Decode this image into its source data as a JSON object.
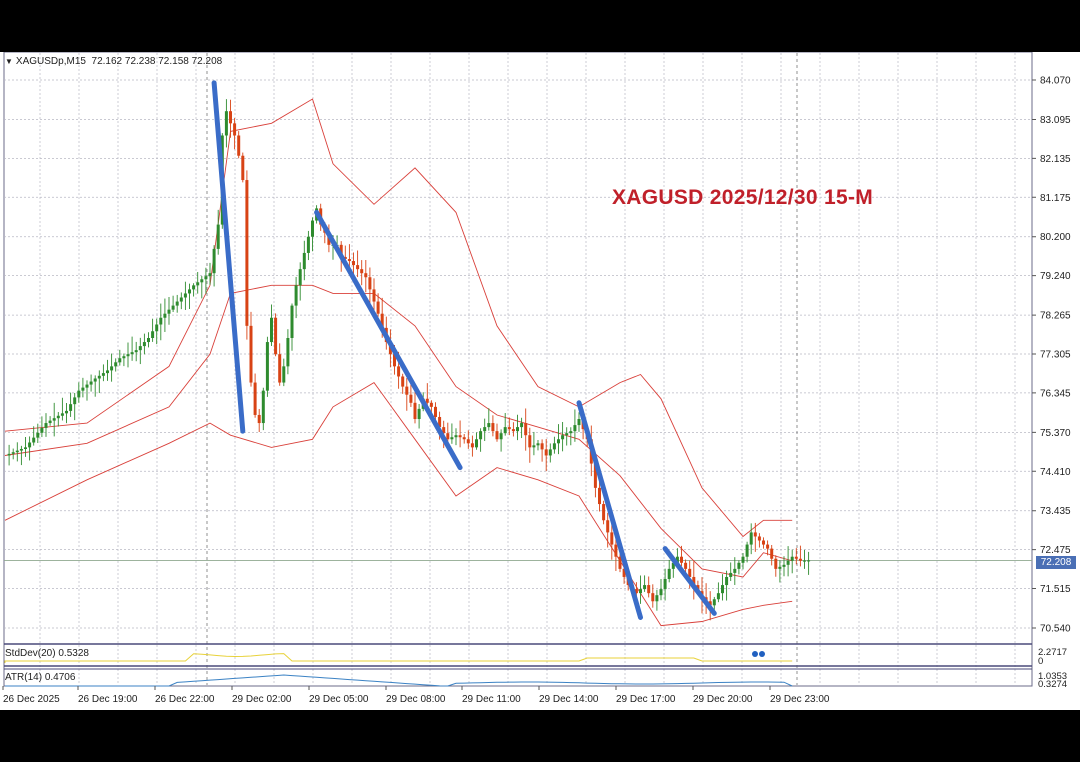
{
  "header": {
    "symbol": "XAGUSDp,M15",
    "ohlc": "72.162 72.238 72.158 72.208"
  },
  "overlay_title": "XAGUSD 2025/12/30 15-M",
  "current_price": "72.208",
  "colors": {
    "bull": "#2e8b2e",
    "bear": "#d84315",
    "band": "#d9403a",
    "trend_line": "#3a6cc8",
    "stddev_line": "#e8d23a",
    "atr_line": "#3b82c4",
    "title": "#c0202a"
  },
  "chart_data": {
    "type": "candlestick",
    "price_ticks": [
      "84.070",
      "83.095",
      "82.135",
      "81.175",
      "80.200",
      "79.240",
      "78.265",
      "77.305",
      "76.345",
      "75.370",
      "74.410",
      "73.435",
      "72.475",
      "71.515",
      "70.540"
    ],
    "time_labels": [
      "26 Dec 2025",
      "26 Dec 19:00",
      "26 Dec 22:00",
      "29 Dec 02:00",
      "29 Dec 05:00",
      "29 Dec 08:00",
      "29 Dec 11:00",
      "29 Dec 14:00",
      "29 Dec 17:00",
      "29 Dec 20:00",
      "29 Dec 23:00"
    ],
    "ylim": [
      70.2,
      84.4
    ],
    "close_anchors": [
      [
        0,
        74.8
      ],
      [
        5,
        75.0
      ],
      [
        10,
        75.6
      ],
      [
        15,
        75.9
      ],
      [
        18,
        76.4
      ],
      [
        22,
        76.7
      ],
      [
        25,
        76.9
      ],
      [
        28,
        77.2
      ],
      [
        32,
        77.4
      ],
      [
        35,
        77.7
      ],
      [
        38,
        78.2
      ],
      [
        42,
        78.6
      ],
      [
        46,
        79.0
      ],
      [
        50,
        79.3
      ],
      [
        52,
        80.5
      ],
      [
        53,
        82.7
      ],
      [
        54,
        83.3
      ],
      [
        56,
        82.7
      ],
      [
        57,
        82.2
      ],
      [
        58,
        81.6
      ],
      [
        59,
        78.0
      ],
      [
        60,
        76.6
      ],
      [
        61,
        75.8
      ],
      [
        62,
        75.6
      ],
      [
        63,
        76.4
      ],
      [
        64,
        77.6
      ],
      [
        65,
        78.2
      ],
      [
        66,
        77.3
      ],
      [
        67,
        76.6
      ],
      [
        68,
        77.0
      ],
      [
        69,
        77.7
      ],
      [
        70,
        78.5
      ],
      [
        71,
        79.0
      ],
      [
        73,
        79.8
      ],
      [
        75,
        80.6
      ],
      [
        76,
        80.9
      ],
      [
        77,
        80.5
      ],
      [
        78,
        80.3
      ],
      [
        79,
        80.0
      ],
      [
        81,
        80.0
      ],
      [
        82,
        79.7
      ],
      [
        84,
        79.6
      ],
      [
        86,
        79.4
      ],
      [
        88,
        79.2
      ],
      [
        91,
        78.3
      ],
      [
        93,
        77.6
      ],
      [
        95,
        77.0
      ],
      [
        97,
        76.5
      ],
      [
        99,
        76.1
      ],
      [
        100,
        75.7
      ],
      [
        102,
        76.2
      ],
      [
        104,
        76.0
      ],
      [
        106,
        75.5
      ],
      [
        108,
        75.2
      ],
      [
        110,
        75.3
      ],
      [
        112,
        75.2
      ],
      [
        114,
        75.0
      ],
      [
        116,
        75.4
      ],
      [
        118,
        75.6
      ],
      [
        120,
        75.2
      ],
      [
        122,
        75.5
      ],
      [
        124,
        75.4
      ],
      [
        126,
        75.6
      ],
      [
        128,
        75.0
      ],
      [
        130,
        75.1
      ],
      [
        132,
        74.8
      ],
      [
        134,
        75.1
      ],
      [
        136,
        75.3
      ],
      [
        138,
        75.4
      ],
      [
        140,
        75.7
      ],
      [
        142,
        75.2
      ],
      [
        144,
        74.0
      ],
      [
        146,
        73.2
      ],
      [
        148,
        72.6
      ],
      [
        150,
        72.0
      ],
      [
        152,
        71.6
      ],
      [
        154,
        71.4
      ],
      [
        156,
        71.6
      ],
      [
        158,
        71.2
      ],
      [
        160,
        71.5
      ],
      [
        162,
        72.0
      ],
      [
        164,
        72.3
      ],
      [
        166,
        72.0
      ],
      [
        168,
        71.6
      ],
      [
        170,
        71.3
      ],
      [
        172,
        71.1
      ],
      [
        174,
        71.4
      ],
      [
        176,
        71.8
      ],
      [
        178,
        72.0
      ],
      [
        180,
        72.3
      ],
      [
        182,
        72.9
      ],
      [
        184,
        72.7
      ],
      [
        186,
        72.5
      ],
      [
        188,
        72.0
      ],
      [
        190,
        72.1
      ],
      [
        192,
        72.3
      ],
      [
        194,
        72.2
      ],
      [
        196,
        72.208
      ]
    ],
    "bollinger": {
      "upper": [
        [
          0,
          75.4
        ],
        [
          20,
          75.6
        ],
        [
          40,
          77.0
        ],
        [
          50,
          79.0
        ],
        [
          55,
          82.8
        ],
        [
          65,
          83.0
        ],
        [
          75,
          83.6
        ],
        [
          80,
          82.0
        ],
        [
          90,
          81.0
        ],
        [
          100,
          81.9
        ],
        [
          110,
          80.8
        ],
        [
          120,
          78.0
        ],
        [
          130,
          76.5
        ],
        [
          140,
          76.0
        ],
        [
          150,
          76.6
        ],
        [
          155,
          76.8
        ],
        [
          160,
          76.2
        ],
        [
          170,
          74.0
        ],
        [
          180,
          72.8
        ],
        [
          185,
          73.2
        ],
        [
          192,
          73.2
        ]
      ],
      "middle": [
        [
          0,
          74.8
        ],
        [
          20,
          75.1
        ],
        [
          40,
          76.0
        ],
        [
          50,
          77.3
        ],
        [
          55,
          78.8
        ],
        [
          65,
          79.0
        ],
        [
          75,
          79.0
        ],
        [
          80,
          78.8
        ],
        [
          90,
          78.8
        ],
        [
          100,
          78.0
        ],
        [
          110,
          76.5
        ],
        [
          120,
          75.8
        ],
        [
          130,
          75.5
        ],
        [
          140,
          75.2
        ],
        [
          150,
          74.3
        ],
        [
          160,
          73.0
        ],
        [
          170,
          72.0
        ],
        [
          180,
          71.8
        ],
        [
          185,
          72.4
        ],
        [
          192,
          72.2
        ]
      ],
      "lower": [
        [
          0,
          73.2
        ],
        [
          20,
          74.2
        ],
        [
          40,
          75.1
        ],
        [
          50,
          75.6
        ],
        [
          55,
          75.3
        ],
        [
          65,
          75.0
        ],
        [
          75,
          75.2
        ],
        [
          80,
          76.0
        ],
        [
          90,
          76.6
        ],
        [
          100,
          75.2
        ],
        [
          110,
          73.8
        ],
        [
          120,
          74.5
        ],
        [
          130,
          74.2
        ],
        [
          140,
          73.8
        ],
        [
          150,
          72.2
        ],
        [
          160,
          70.6
        ],
        [
          170,
          70.7
        ],
        [
          180,
          71.0
        ],
        [
          185,
          71.1
        ],
        [
          192,
          71.2
        ]
      ]
    },
    "trend_lines": [
      [
        [
          51,
          84.0
        ],
        [
          58,
          75.4
        ]
      ],
      [
        [
          76,
          80.8
        ],
        [
          111,
          74.5
        ]
      ],
      [
        [
          140,
          76.1
        ],
        [
          155,
          70.8
        ]
      ],
      [
        [
          161,
          72.5
        ],
        [
          173,
          70.9
        ]
      ]
    ],
    "indicators": [
      {
        "label": "StdDev(20) 0.5328",
        "ticks": [
          "2.2717",
          "0"
        ]
      },
      {
        "label": "ATR(14) 0.4706",
        "ticks": [
          "1.0353",
          "0.3274"
        ]
      }
    ]
  }
}
